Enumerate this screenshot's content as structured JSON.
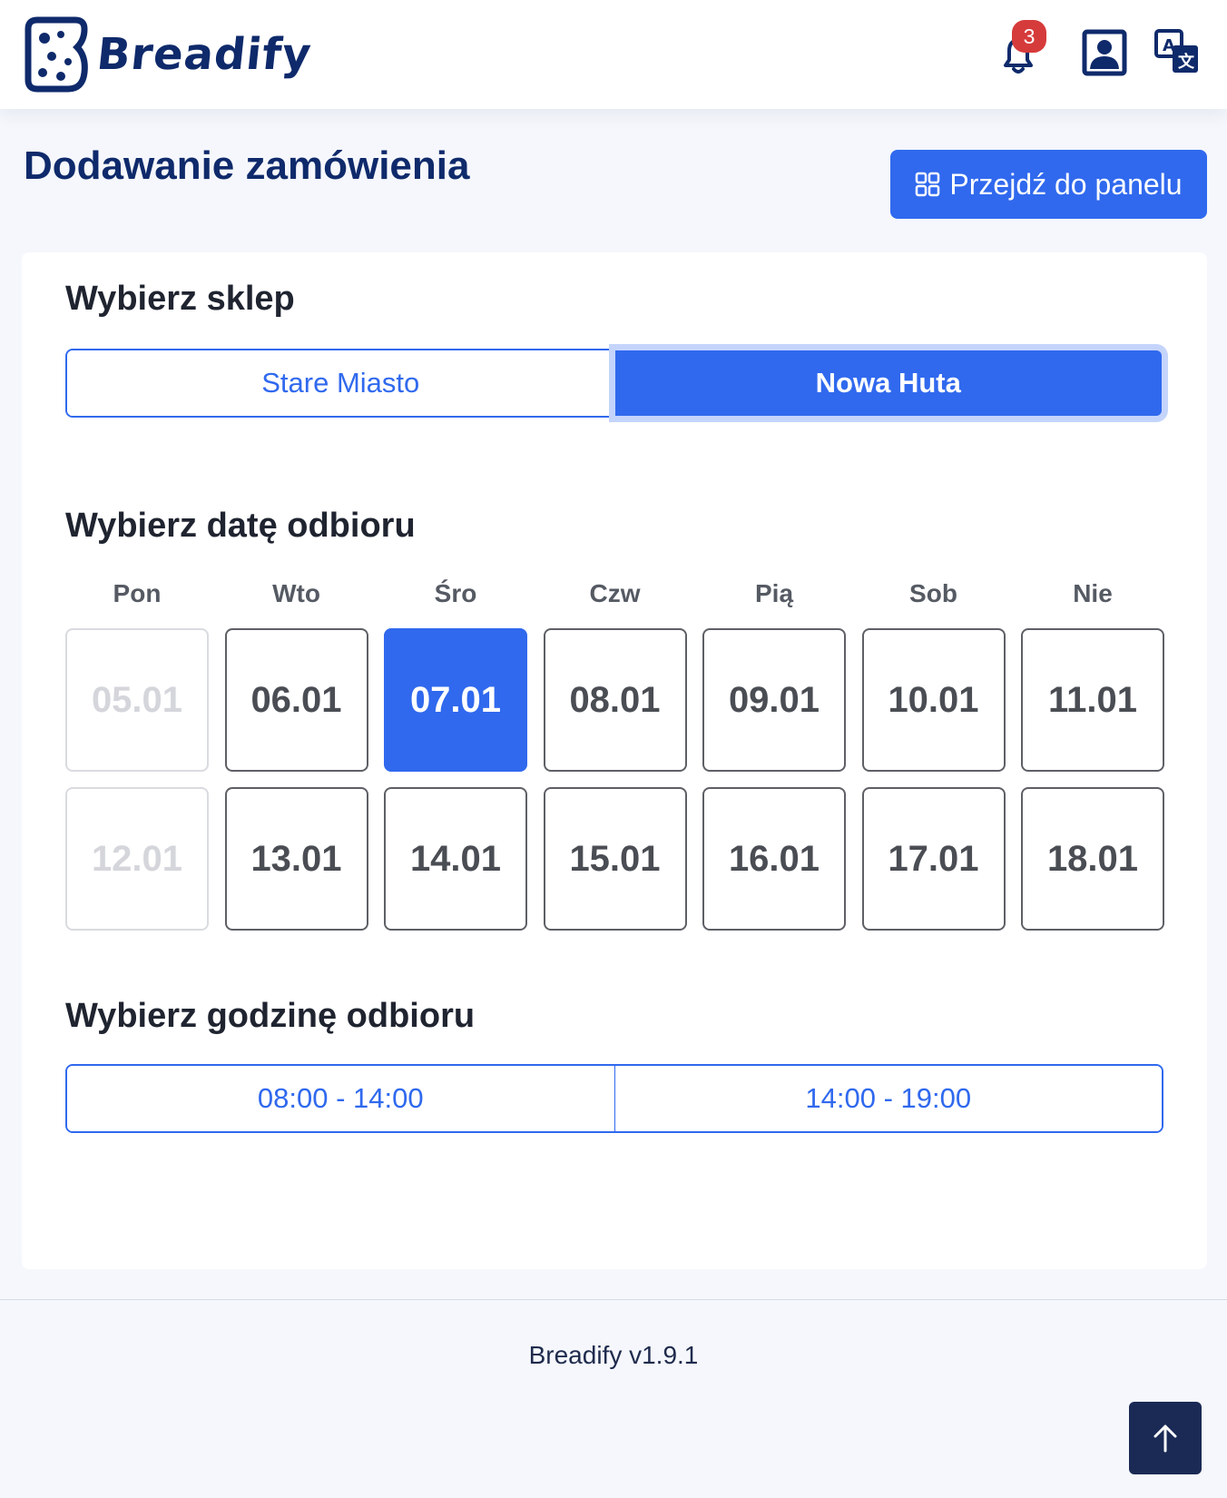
{
  "header": {
    "logo_text": "Breadify",
    "notification_count": "3",
    "icons": [
      "bell-icon",
      "user-profile-icon",
      "translate-icon"
    ]
  },
  "page": {
    "title": "Dodawanie zamówienia",
    "panel_button_label": "Przejdź do panelu",
    "panel_button_icon": "grid-icon"
  },
  "store": {
    "title": "Wybierz sklep",
    "options": [
      "Stare Miasto",
      "Nowa Huta"
    ],
    "selected": "Nowa Huta"
  },
  "date": {
    "title": "Wybierz datę odbioru",
    "weekdays": [
      "Pon",
      "Wto",
      "Śro",
      "Czw",
      "Pią",
      "Sob",
      "Nie"
    ],
    "rows": [
      [
        "05.01",
        "06.01",
        "07.01",
        "08.01",
        "09.01",
        "10.01",
        "11.01"
      ],
      [
        "12.01",
        "13.01",
        "14.01",
        "15.01",
        "16.01",
        "17.01",
        "18.01"
      ]
    ],
    "disabled": [
      "05.01",
      "12.01"
    ],
    "selected": "07.01"
  },
  "time": {
    "title": "Wybierz godzinę odbioru",
    "options": [
      "08:00 - 14:00",
      "14:00 - 19:00"
    ]
  },
  "footer": {
    "version": "Breadify v1.9.1",
    "scroll_top_icon": "arrow-up-icon"
  },
  "colors": {
    "primary": "#3069ee",
    "navy": "#0f2a6b",
    "badge": "#d63b3b",
    "scroll_button": "#1a2a55"
  }
}
